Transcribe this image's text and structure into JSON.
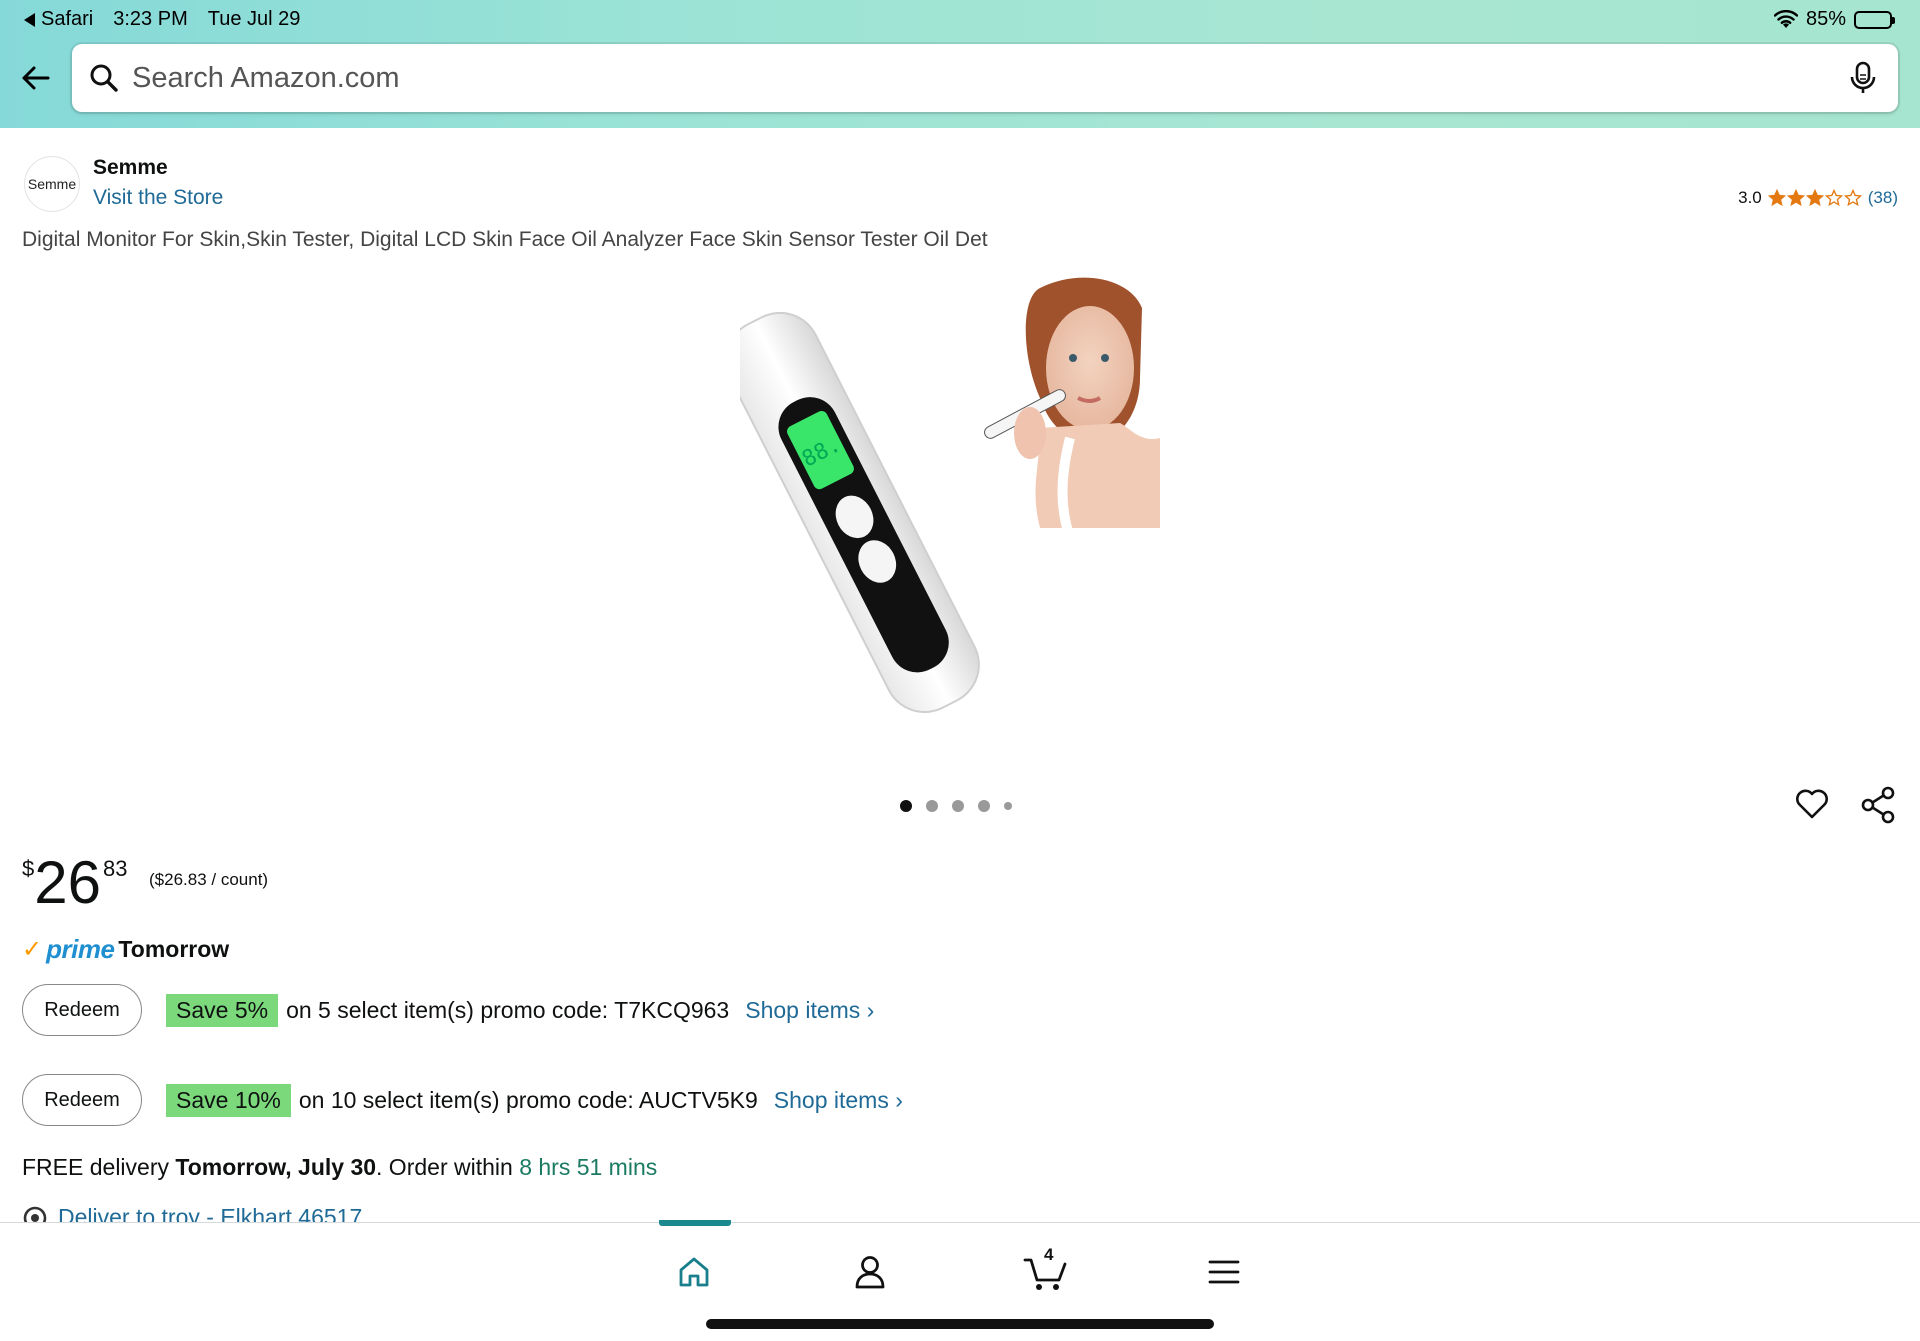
{
  "status_bar": {
    "app": "Safari",
    "time": "3:23 PM",
    "date": "Tue Jul 29",
    "battery": "85%",
    "battery_level": 0.85
  },
  "search": {
    "placeholder": "Search Amazon.com"
  },
  "brand": {
    "logo_text": "Semme",
    "name": "Semme",
    "visit_store": "Visit the Store"
  },
  "rating": {
    "value": "3.0",
    "stars": 3,
    "count": "(38)"
  },
  "product": {
    "title": "Digital Monitor For Skin,Skin Tester, Digital LCD Skin Face Oil Analyzer Face Skin Sensor Tester Oil Det",
    "image_count": 5,
    "active_image": 0
  },
  "price": {
    "symbol": "$",
    "whole": "26",
    "fraction": "83",
    "unit_price": "($26.83 / count)"
  },
  "prime": {
    "check": "✓",
    "word": "prime",
    "day": "Tomorrow"
  },
  "promos": [
    {
      "button": "Redeem",
      "badge": "Save 5%",
      "text": "on 5 select item(s) promo code: T7KCQ963",
      "link": "Shop items ›"
    },
    {
      "button": "Redeem",
      "badge": "Save 10%",
      "text": "on 10 select item(s) promo code: AUCTV5K9",
      "link": "Shop items ›"
    }
  ],
  "delivery": {
    "prefix": "FREE delivery ",
    "date": "Tomorrow, July 30",
    "mid": ". Order within ",
    "timer": "8 hrs 51 mins",
    "deliver_to": "Deliver to troy - Elkhart 46517"
  },
  "nav": {
    "cart_count": "4"
  },
  "colors": {
    "link": "#1f6a96",
    "prime_blue": "#1f8fd1",
    "save_badge": "#7bd97b",
    "timer_green": "#1b7b62",
    "star_orange": "#e47911"
  }
}
